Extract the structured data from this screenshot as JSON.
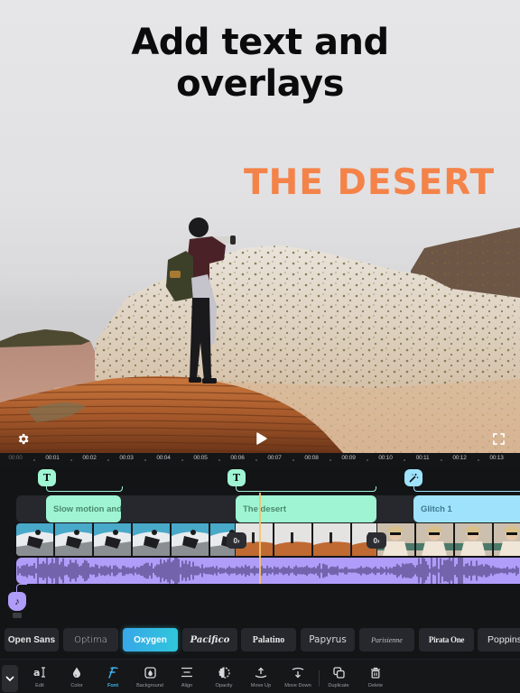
{
  "preview": {
    "headline_line1": "Add text and",
    "headline_line2": "overlays",
    "overlay_text": "THE DESERT",
    "overlay_color": "#f4834a",
    "settings_icon": "gear-icon",
    "play_icon": "play-icon",
    "fullscreen_icon": "fullscreen-icon"
  },
  "ruler": {
    "ticks": [
      "00:00",
      "00:01",
      "00:02",
      "00:03",
      "00:04",
      "00:05",
      "00:06",
      "00:07",
      "00:08",
      "00:09",
      "00:10",
      "00:11",
      "00:12",
      "00:13"
    ]
  },
  "timeline": {
    "text_clips": [
      {
        "label": "Slow motion and",
        "marker_icon": "T"
      },
      {
        "label": "The desert",
        "marker_icon": "T"
      }
    ],
    "effect_clip": {
      "label": "Glitch 1",
      "marker_icon": "magic-wand-icon"
    },
    "transition_icon_label": "0›",
    "audio_marker_icon": "♪",
    "colors": {
      "text_clip": "#9ff5d3",
      "effect_clip": "#9ee3fb",
      "audio": "#b09cf9",
      "playhead": "#f5c36b"
    }
  },
  "fonts": {
    "items": [
      "Open Sans",
      "Optima",
      "Oxygen",
      "Pacifico",
      "Palatino",
      "Papyrus",
      "Parisienne",
      "Pirata One",
      "Poppins"
    ],
    "selected": "Oxygen"
  },
  "toolbar": {
    "items": [
      {
        "label": "Edit",
        "icon": "edit-text-icon"
      },
      {
        "label": "Color",
        "icon": "color-drop-icon"
      },
      {
        "label": "Font",
        "icon": "font-icon"
      },
      {
        "label": "Background",
        "icon": "background-icon"
      },
      {
        "label": "Align",
        "icon": "align-icon"
      },
      {
        "label": "Opacity",
        "icon": "opacity-icon"
      },
      {
        "label": "Move Up",
        "icon": "move-up-icon"
      },
      {
        "label": "Move Down",
        "icon": "move-down-icon"
      },
      {
        "label": "Duplicate",
        "icon": "duplicate-icon"
      },
      {
        "label": "Delete",
        "icon": "trash-icon"
      }
    ],
    "active": "Font",
    "accent": "#3fb4f0"
  }
}
